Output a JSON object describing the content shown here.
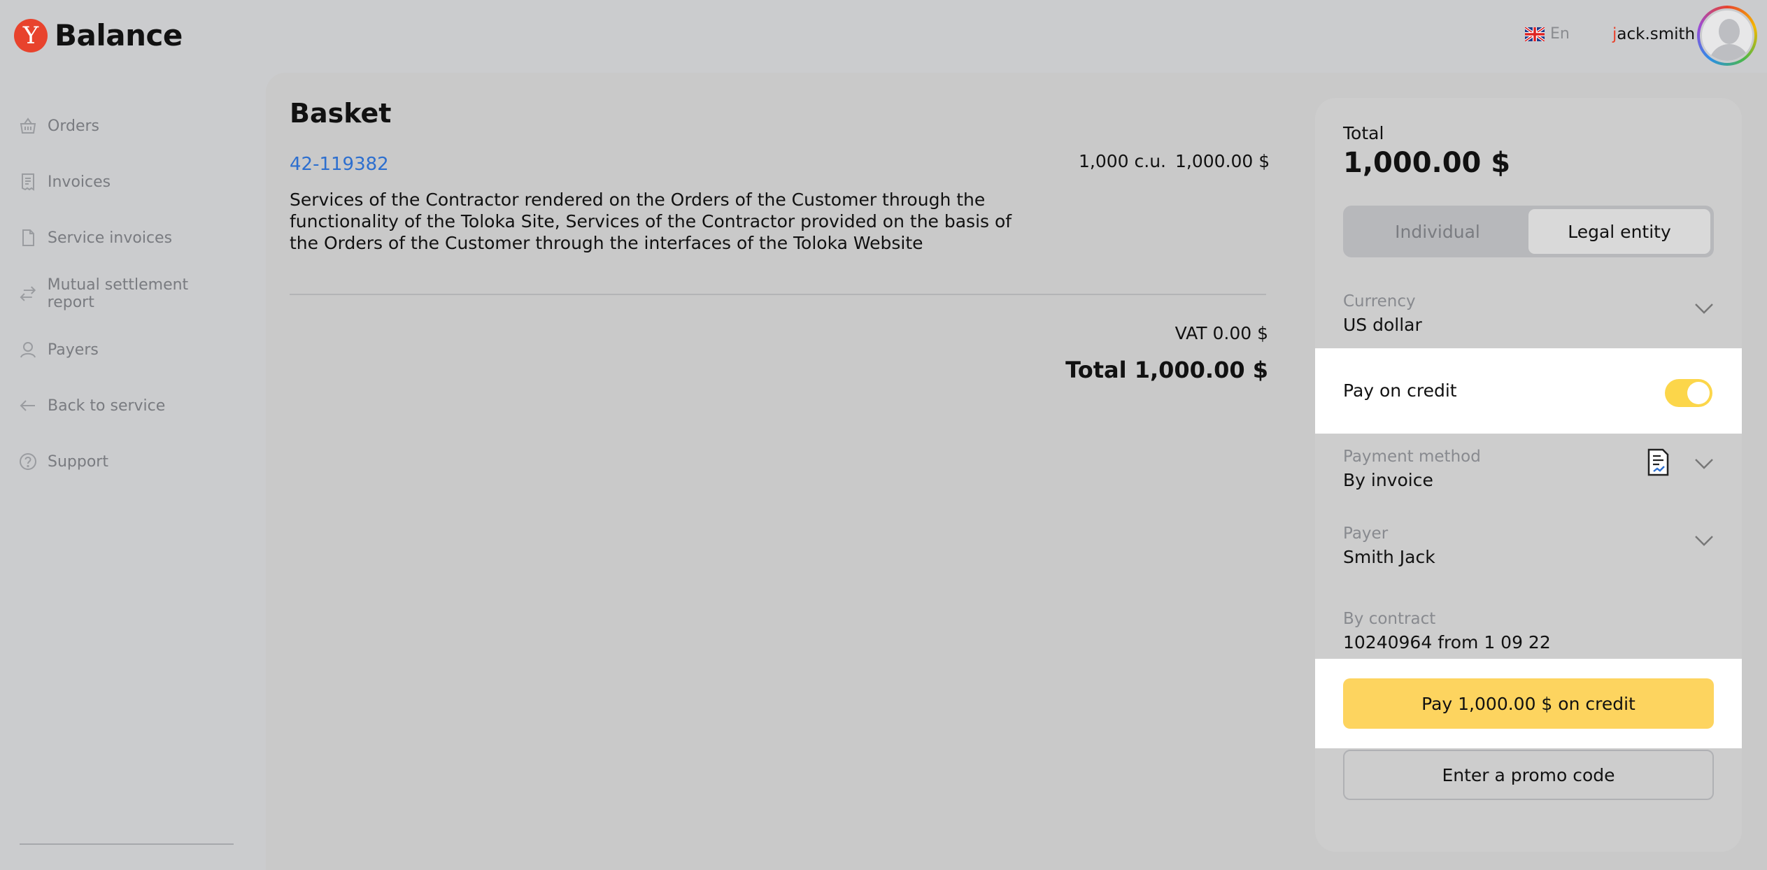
{
  "header": {
    "logo_letter": "Y",
    "app_name": "Balance",
    "language": "En",
    "username_first": "j",
    "username_rest": "ack.smith"
  },
  "sidebar": {
    "items": [
      {
        "label": "Orders",
        "icon": "basket-icon"
      },
      {
        "label": "Invoices",
        "icon": "receipt-icon"
      },
      {
        "label": "Service invoices",
        "icon": "document-icon"
      },
      {
        "label": "Mutual settlement report",
        "icon": "arrows-exchange-icon"
      },
      {
        "label": "Payers",
        "icon": "person-icon"
      },
      {
        "label": "Back to service",
        "icon": "arrow-left-icon"
      },
      {
        "label": "Support",
        "icon": "help-circle-icon"
      }
    ]
  },
  "basket": {
    "title": "Basket",
    "order_id": "42-119382",
    "quantity": "1,000 c.u.",
    "amount": "1,000.00 $",
    "description": "Services of the Contractor rendered on the Orders of the Customer through the functionality of the Toloka Site, Services of the Contractor provided on the basis of the Orders of the Customer through the interfaces of the Toloka Website",
    "vat": "VAT 0.00 $",
    "total": "Total 1,000.00 $"
  },
  "card": {
    "total_label": "Total",
    "total_value": "1,000.00 $",
    "segments": [
      "Individual",
      "Legal entity"
    ],
    "active_segment": "Legal entity",
    "currency_label": "Currency",
    "currency_value": "US dollar",
    "credit_label": "Pay on credit",
    "credit_enabled": true,
    "payment_method_label": "Payment method",
    "payment_method_value": "By invoice",
    "payer_label": "Payer",
    "payer_value": "Smith Jack",
    "contract_label": "By contract",
    "contract_value": "10240964 from 1 09 22",
    "pay_button": "Pay 1,000.00 $ on credit",
    "promo_button": "Enter a promo code"
  },
  "colors": {
    "accent_yellow": "#fdd45f",
    "brand_red": "#e8432d",
    "link_blue": "#2d6fcf"
  }
}
